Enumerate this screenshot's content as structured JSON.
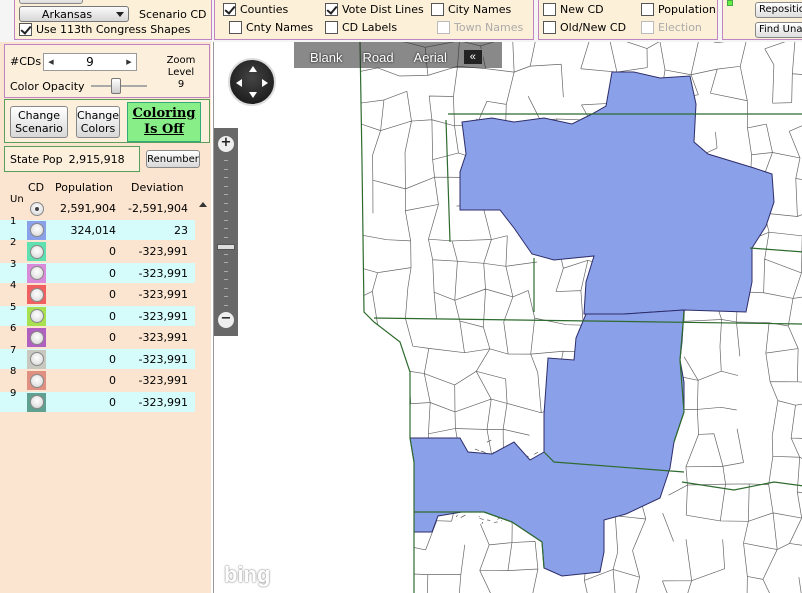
{
  "top": {
    "state_select": "Arkansas",
    "scenario_label": "Scenario CD",
    "use_shapes": {
      "label": "Use 113th Congress Shapes",
      "checked": true
    },
    "layers": [
      {
        "label": "Counties",
        "checked": true,
        "disabled": false
      },
      {
        "label": "Vote Dist Lines",
        "checked": true,
        "disabled": false
      },
      {
        "label": "City Names",
        "checked": false,
        "disabled": false
      },
      {
        "label": "Cnty Names",
        "checked": false,
        "disabled": false
      },
      {
        "label": "CD Labels",
        "checked": false,
        "disabled": false
      },
      {
        "label": "Town Names",
        "checked": false,
        "disabled": true
      }
    ],
    "cd_options": [
      {
        "label": "New CD",
        "checked": false,
        "disabled": false
      },
      {
        "label": "Population",
        "checked": false,
        "disabled": false
      },
      {
        "label": "Old/New CD",
        "checked": false,
        "disabled": false
      },
      {
        "label": "Election",
        "checked": false,
        "disabled": true
      }
    ],
    "tools": {
      "reposition": "Repositio",
      "find_unassigned": "Find Unas"
    }
  },
  "controls": {
    "num_cds_label": "#CDs",
    "num_cds_value": "9",
    "color_opacity_label": "Color Opacity",
    "color_opacity_level": 0.5,
    "zoom_label": "Zoom Level",
    "zoom_value": "9",
    "change_scenario": "Change Scenario",
    "change_colors": "Change Colors",
    "coloring_toggle": "Coloring Is Off",
    "state_pop_label": "State Pop",
    "state_pop_value": "2,915,918",
    "renumber": "Renumber"
  },
  "table": {
    "headers": {
      "cd": "CD",
      "population": "Population",
      "deviation": "Deviation"
    },
    "rows": [
      {
        "id": "Un",
        "color": "none",
        "population": "2,591,904",
        "deviation": "-2,591,904",
        "selected": true,
        "highlight": false
      },
      {
        "id": "1",
        "color": "#8aa0e8",
        "population": "324,014",
        "deviation": "23",
        "selected": false,
        "highlight": true
      },
      {
        "id": "2",
        "color": "#5ee0b0",
        "population": "0",
        "deviation": "-323,991",
        "selected": false,
        "highlight": false
      },
      {
        "id": "3",
        "color": "#d98ad9",
        "population": "0",
        "deviation": "-323,991",
        "selected": false,
        "highlight": true
      },
      {
        "id": "4",
        "color": "#f06060",
        "population": "0",
        "deviation": "-323,991",
        "selected": false,
        "highlight": false
      },
      {
        "id": "5",
        "color": "#a8e050",
        "population": "0",
        "deviation": "-323,991",
        "selected": false,
        "highlight": true
      },
      {
        "id": "6",
        "color": "#b060c0",
        "population": "0",
        "deviation": "-323,991",
        "selected": false,
        "highlight": false
      },
      {
        "id": "7",
        "color": "#c8c8c0",
        "population": "0",
        "deviation": "-323,991",
        "selected": false,
        "highlight": true
      },
      {
        "id": "8",
        "color": "#e09080",
        "population": "0",
        "deviation": "-323,991",
        "selected": false,
        "highlight": false
      },
      {
        "id": "9",
        "color": "#60a090",
        "population": "0",
        "deviation": "-323,991",
        "selected": false,
        "highlight": true
      }
    ]
  },
  "map": {
    "toolbar": [
      "Blank",
      "Road",
      "Aerial"
    ],
    "collapse": "«",
    "zoom_in": "+",
    "zoom_out": "−",
    "logo": "bing",
    "district_fill": "#8aa0e8",
    "county_line_color": "#2e6b2e",
    "vd_line_color": "#666666"
  }
}
